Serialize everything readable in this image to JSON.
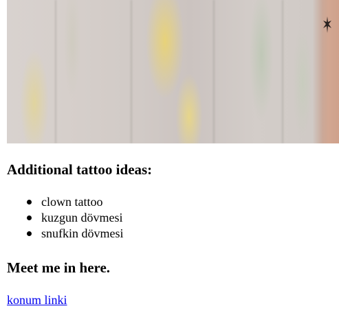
{
  "photo": {
    "alt": "",
    "icon": "tattoo-photo-image"
  },
  "sections": {
    "ideas_heading": "Additional tattoo ideas:",
    "ideas": [
      "clown tattoo",
      "kuzgun dövmesi",
      "snufkin dövmesi"
    ],
    "meet_heading": "Meet me in here.",
    "location_link": "konum linki"
  },
  "colors": {
    "link": "#0000ee",
    "text": "#000000",
    "background": "#ffffff"
  }
}
